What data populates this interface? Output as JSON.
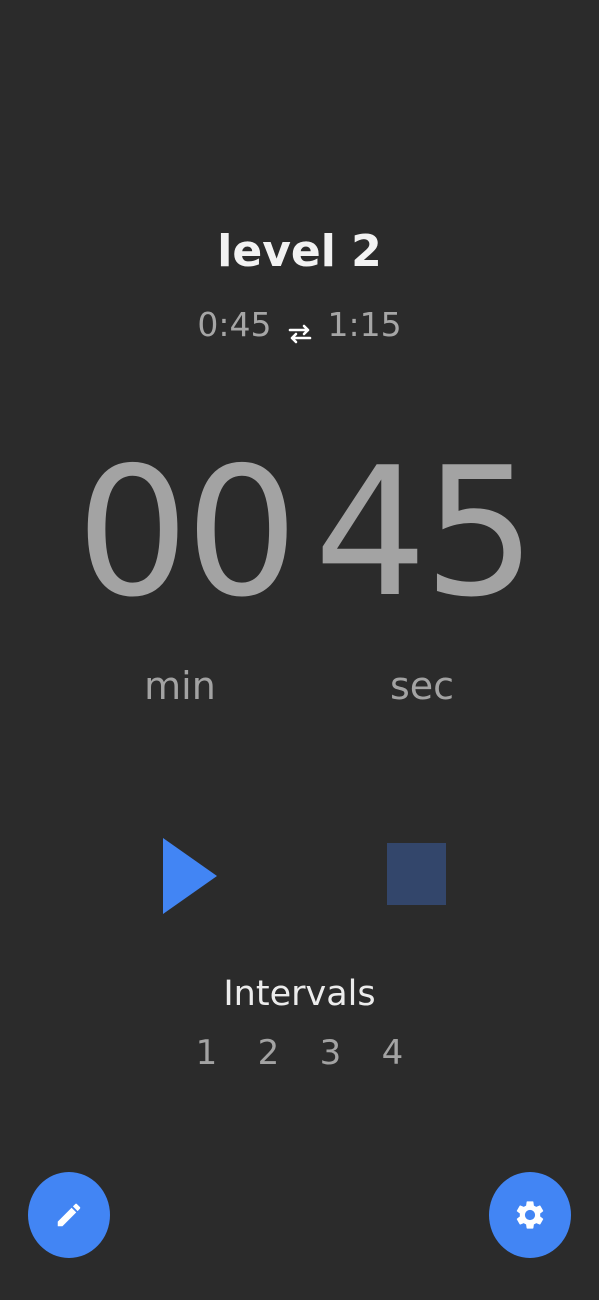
{
  "header": {
    "title": "level 2",
    "work_time": "0:45",
    "rest_time": "1:15"
  },
  "timer": {
    "minutes": "00",
    "seconds": "45",
    "minutes_unit": "min",
    "seconds_unit": "sec"
  },
  "controls": {
    "play_icon": "play-icon",
    "stop_icon": "stop-icon"
  },
  "intervals": {
    "label": "Intervals",
    "items": [
      "1",
      "2",
      "3",
      "4"
    ]
  },
  "fabs": {
    "edit_icon": "pencil-icon",
    "settings_icon": "gear-icon"
  },
  "colors": {
    "background": "#2b2b2b",
    "accent": "#4285f4",
    "stop_button": "#33466b",
    "timer_text": "#a3a3a3"
  }
}
